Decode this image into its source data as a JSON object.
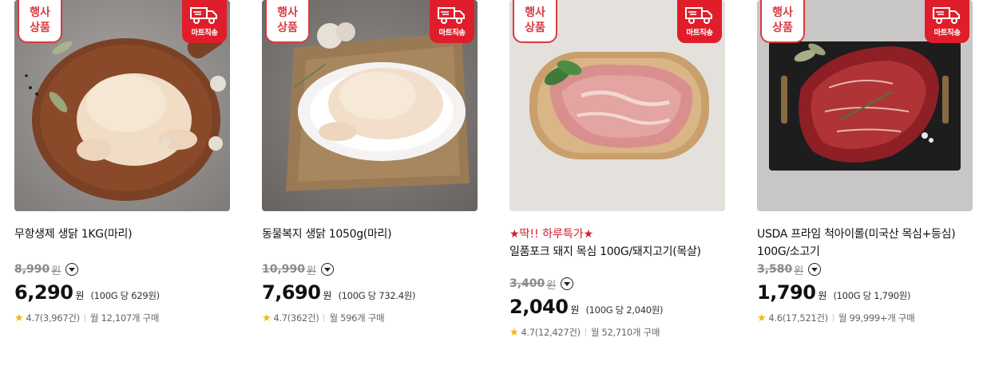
{
  "colors": {
    "accent_red": "#e01e2b",
    "badge_red": "#d93a3f",
    "star": "#f5b400"
  },
  "products": [
    {
      "event_badge": [
        "행사",
        "상품"
      ],
      "mart_badge": "마트직송",
      "promo": "",
      "name_lines": [
        "무항생제 생닭 1KG(마리)"
      ],
      "original_price": "8,990",
      "price": "6,290",
      "currency": "원",
      "unit_price": "(100G 당 629원)",
      "rating": "4.7(3,967건)",
      "sales": "월 12,107개 구매"
    },
    {
      "event_badge": [
        "행사",
        "상품"
      ],
      "mart_badge": "마트직송",
      "promo": "",
      "name_lines": [
        "동물복지 생닭 1050g(마리)"
      ],
      "original_price": "10,990",
      "price": "7,690",
      "currency": "원",
      "unit_price": "(100G 당 732.4원)",
      "rating": "4.7(362건)",
      "sales": "월 596개 구매"
    },
    {
      "event_badge": [
        "행사",
        "상품"
      ],
      "mart_badge": "마트직송",
      "promo": "★딱!! 하루특가★",
      "name_lines": [
        "일품포크 돼지 목심 100G/돼지고기(목살)"
      ],
      "original_price": "3,400",
      "price": "2,040",
      "currency": "원",
      "unit_price": "(100G 당 2,040원)",
      "rating": "4.7(12,427건)",
      "sales": "월 52,710개 구매"
    },
    {
      "event_badge": [
        "행사",
        "상품"
      ],
      "mart_badge": "마트직송",
      "promo": "",
      "name_lines": [
        "USDA 프라임 척아이롤(미국산 목심+등심)",
        "100G/소고기"
      ],
      "original_price": "3,580",
      "price": "1,790",
      "currency": "원",
      "unit_price": "(100G 당 1,790원)",
      "rating": "4.6(17,521건)",
      "sales": "월 99,999+개 구매"
    }
  ]
}
